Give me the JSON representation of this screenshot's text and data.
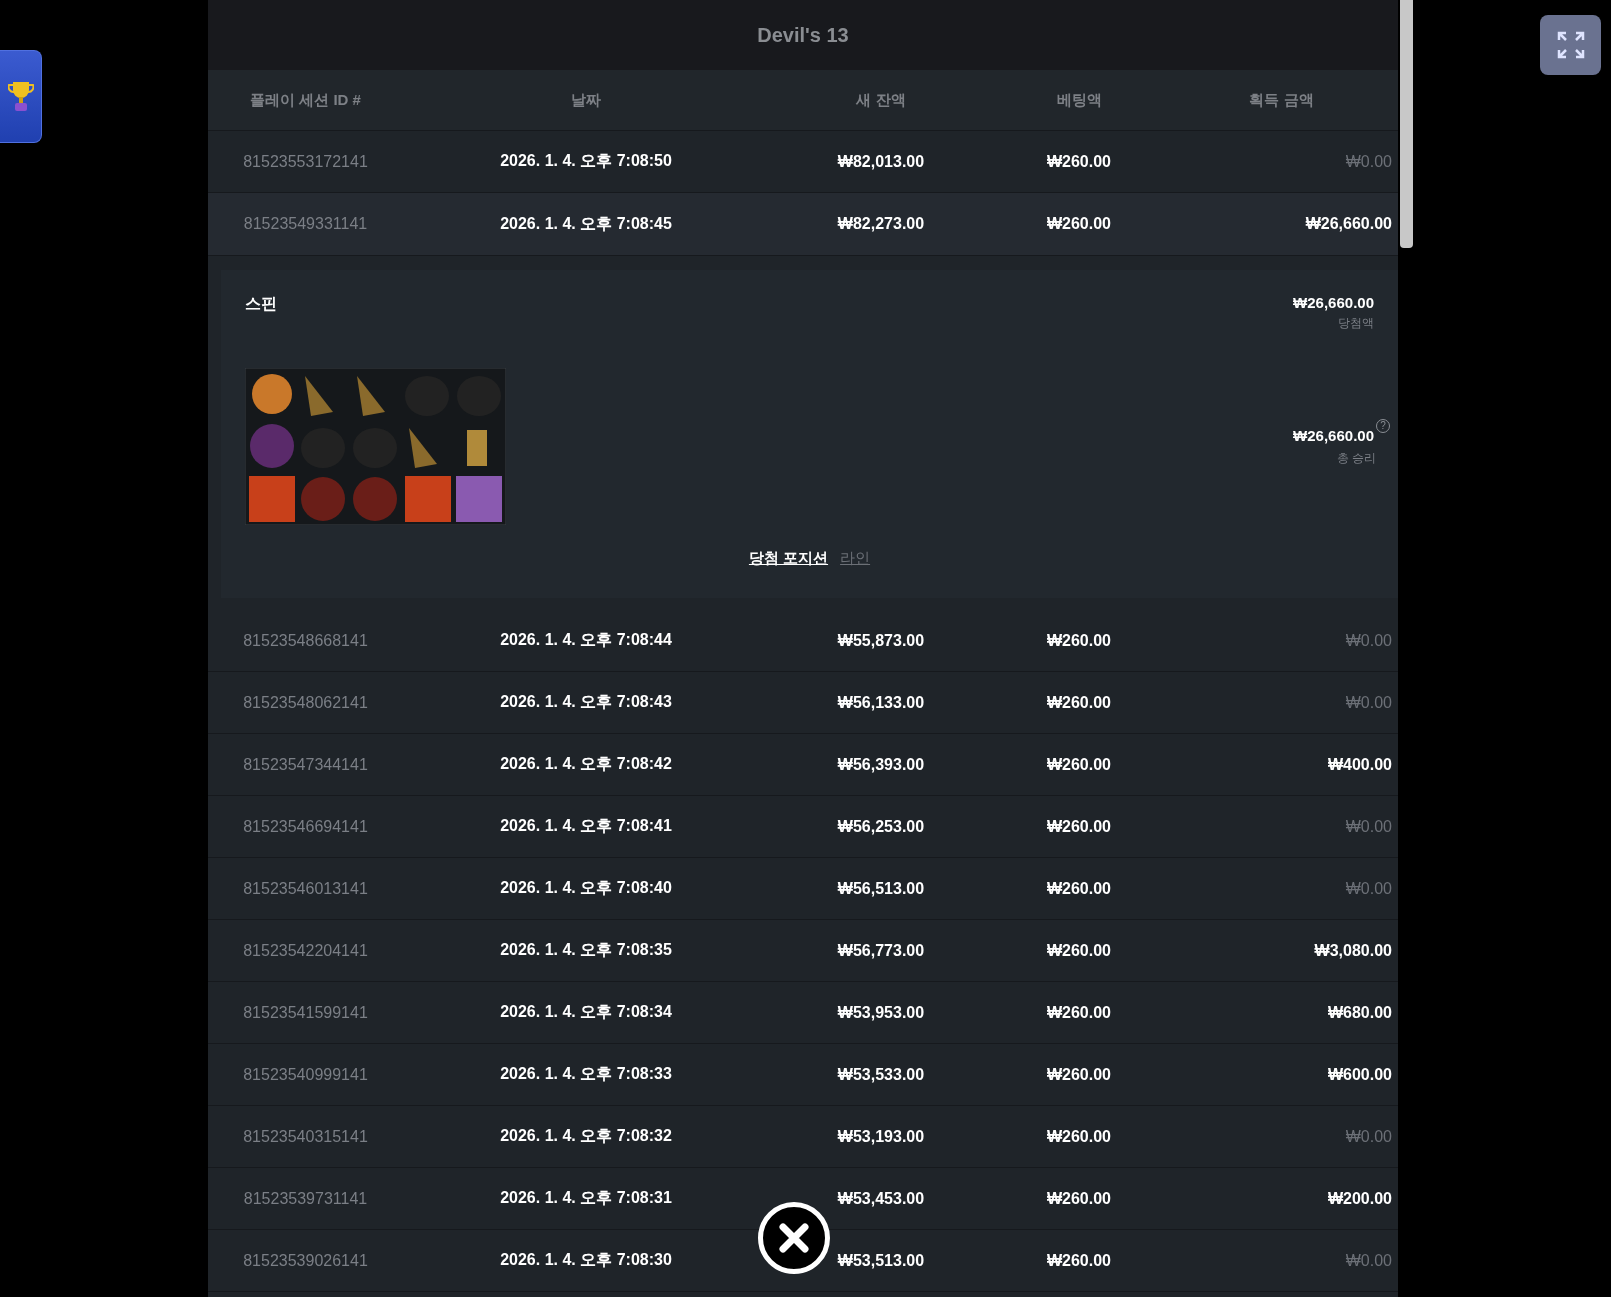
{
  "title": "Devil's 13",
  "columns": [
    "플레이 세션 ID #",
    "날짜",
    "새 잔액",
    "베팅액",
    "획득 금액"
  ],
  "rows": [
    {
      "session_id": "81523553172141",
      "date": "2026. 1. 4. 오후 7:08:50",
      "balance": "₩82,013.00",
      "bet": "₩260.00",
      "win": "₩0.00",
      "dimmed": true,
      "expanded": false
    },
    {
      "session_id": "81523549331141",
      "date": "2026. 1. 4. 오후 7:08:45",
      "balance": "₩82,273.00",
      "bet": "₩260.00",
      "win": "₩26,660.00",
      "dimmed": false,
      "expanded": true,
      "detail": {
        "label": "스핀",
        "win_amount": "₩26,660.00",
        "win_caption": "당첨액",
        "total": "₩26,660.00",
        "total_caption": "총 승리",
        "help": "?",
        "tabs": [
          {
            "label": "당첨 포지션",
            "selected": true
          },
          {
            "label": "라인",
            "selected": false
          }
        ]
      }
    },
    {
      "session_id": "81523548668141",
      "date": "2026. 1. 4. 오후 7:08:44",
      "balance": "₩55,873.00",
      "bet": "₩260.00",
      "win": "₩0.00",
      "dimmed": true,
      "expanded": false
    },
    {
      "session_id": "81523548062141",
      "date": "2026. 1. 4. 오후 7:08:43",
      "balance": "₩56,133.00",
      "bet": "₩260.00",
      "win": "₩0.00",
      "dimmed": true,
      "expanded": false
    },
    {
      "session_id": "81523547344141",
      "date": "2026. 1. 4. 오후 7:08:42",
      "balance": "₩56,393.00",
      "bet": "₩260.00",
      "win": "₩400.00",
      "dimmed": false,
      "expanded": false
    },
    {
      "session_id": "81523546694141",
      "date": "2026. 1. 4. 오후 7:08:41",
      "balance": "₩56,253.00",
      "bet": "₩260.00",
      "win": "₩0.00",
      "dimmed": true,
      "expanded": false
    },
    {
      "session_id": "81523546013141",
      "date": "2026. 1. 4. 오후 7:08:40",
      "balance": "₩56,513.00",
      "bet": "₩260.00",
      "win": "₩0.00",
      "dimmed": true,
      "expanded": false
    },
    {
      "session_id": "81523542204141",
      "date": "2026. 1. 4. 오후 7:08:35",
      "balance": "₩56,773.00",
      "bet": "₩260.00",
      "win": "₩3,080.00",
      "dimmed": false,
      "expanded": false
    },
    {
      "session_id": "81523541599141",
      "date": "2026. 1. 4. 오후 7:08:34",
      "balance": "₩53,953.00",
      "bet": "₩260.00",
      "win": "₩680.00",
      "dimmed": false,
      "expanded": false
    },
    {
      "session_id": "81523540999141",
      "date": "2026. 1. 4. 오후 7:08:33",
      "balance": "₩53,533.00",
      "bet": "₩260.00",
      "win": "₩600.00",
      "dimmed": false,
      "expanded": false
    },
    {
      "session_id": "81523540315141",
      "date": "2026. 1. 4. 오후 7:08:32",
      "balance": "₩53,193.00",
      "bet": "₩260.00",
      "win": "₩0.00",
      "dimmed": true,
      "expanded": false
    },
    {
      "session_id": "81523539731141",
      "date": "2026. 1. 4. 오후 7:08:31",
      "balance": "₩53,453.00",
      "bet": "₩260.00",
      "win": "₩200.00",
      "dimmed": false,
      "expanded": false
    },
    {
      "session_id": "81523539026141",
      "date": "2026. 1. 4. 오후 7:08:30",
      "balance": "₩53,513.00",
      "bet": "₩260.00",
      "win": "₩0.00",
      "dimmed": true,
      "expanded": false
    }
  ]
}
